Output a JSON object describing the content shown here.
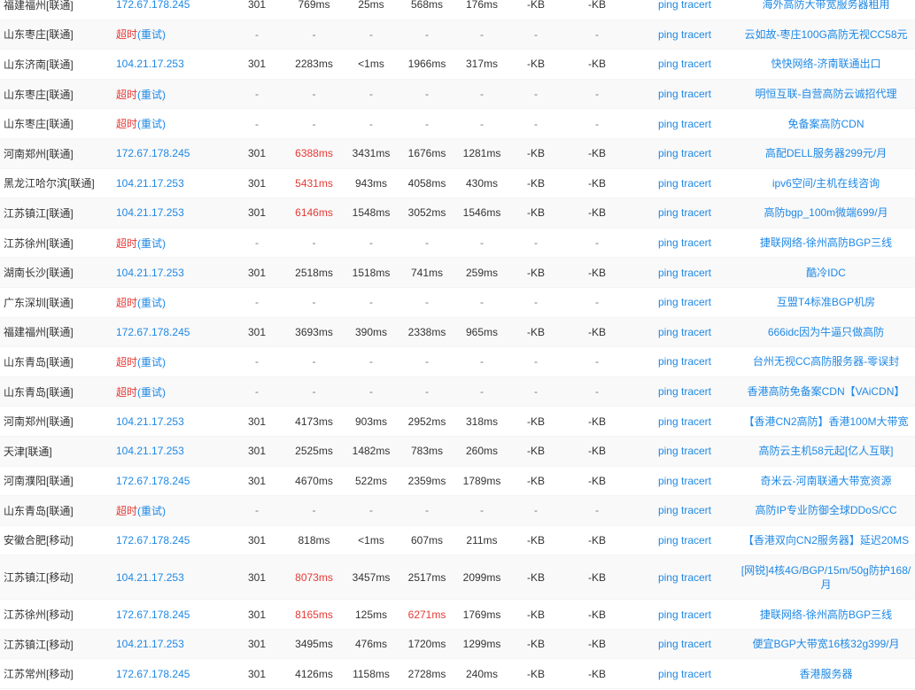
{
  "colors": {
    "link": "#1e88e5",
    "alert": "#e53935",
    "text": "#333333",
    "row_alt": "#f9f9f9"
  },
  "timeout_label": "超时",
  "retry_label": "(重试)",
  "dash": "-",
  "rows": [
    {
      "loc": "福建福州[联通]",
      "ip": "172.67.178.245",
      "status": "301",
      "t1": "769ms",
      "t2": "25ms",
      "t3": "568ms",
      "t4": "176ms",
      "kb1": "-KB",
      "kb2": "-KB",
      "ping": "ping",
      "tracert": "tracert",
      "ad": "海外高防大带宽服务器租用",
      "red": []
    },
    {
      "loc": "山东枣庄[联通]",
      "timeout": true,
      "ping": "ping",
      "tracert": "tracert",
      "ad": "云如故-枣庄100G高防无视CC58元"
    },
    {
      "loc": "山东济南[联通]",
      "ip": "104.21.17.253",
      "status": "301",
      "t1": "2283ms",
      "t2": "<1ms",
      "t3": "1966ms",
      "t4": "317ms",
      "kb1": "-KB",
      "kb2": "-KB",
      "ping": "ping",
      "tracert": "tracert",
      "ad": "快快网络-济南联通出口",
      "red": []
    },
    {
      "loc": "山东枣庄[联通]",
      "timeout": true,
      "ping": "ping",
      "tracert": "tracert",
      "ad": "明恒互联-自营高防云诚招代理"
    },
    {
      "loc": "山东枣庄[联通]",
      "timeout": true,
      "ping": "ping",
      "tracert": "tracert",
      "ad": "免备案高防CDN"
    },
    {
      "loc": "河南郑州[联通]",
      "ip": "172.67.178.245",
      "status": "301",
      "t1": "6388ms",
      "t2": "3431ms",
      "t3": "1676ms",
      "t4": "1281ms",
      "kb1": "-KB",
      "kb2": "-KB",
      "ping": "ping",
      "tracert": "tracert",
      "ad": "高配DELL服务器299元/月",
      "red": [
        "t1"
      ]
    },
    {
      "loc": "黑龙江哈尔滨[联通]",
      "ip": "104.21.17.253",
      "status": "301",
      "t1": "5431ms",
      "t2": "943ms",
      "t3": "4058ms",
      "t4": "430ms",
      "kb1": "-KB",
      "kb2": "-KB",
      "ping": "ping",
      "tracert": "tracert",
      "ad": "ipv6空间/主机在线咨询",
      "red": [
        "t1"
      ]
    },
    {
      "loc": "江苏镇江[联通]",
      "ip": "104.21.17.253",
      "status": "301",
      "t1": "6146ms",
      "t2": "1548ms",
      "t3": "3052ms",
      "t4": "1546ms",
      "kb1": "-KB",
      "kb2": "-KB",
      "ping": "ping",
      "tracert": "tracert",
      "ad": "高防bgp_100m微端699/月",
      "red": [
        "t1"
      ]
    },
    {
      "loc": "江苏徐州[联通]",
      "timeout": true,
      "ping": "ping",
      "tracert": "tracert",
      "ad": "捷联网络-徐州高防BGP三线"
    },
    {
      "loc": "湖南长沙[联通]",
      "ip": "104.21.17.253",
      "status": "301",
      "t1": "2518ms",
      "t2": "1518ms",
      "t3": "741ms",
      "t4": "259ms",
      "kb1": "-KB",
      "kb2": "-KB",
      "ping": "ping",
      "tracert": "tracert",
      "ad": "酷冷IDC",
      "red": []
    },
    {
      "loc": "广东深圳[联通]",
      "timeout": true,
      "ping": "ping",
      "tracert": "tracert",
      "ad": "互盟T4标准BGP机房"
    },
    {
      "loc": "福建福州[联通]",
      "ip": "172.67.178.245",
      "status": "301",
      "t1": "3693ms",
      "t2": "390ms",
      "t3": "2338ms",
      "t4": "965ms",
      "kb1": "-KB",
      "kb2": "-KB",
      "ping": "ping",
      "tracert": "tracert",
      "ad": "666idc因为牛逼只做高防",
      "red": []
    },
    {
      "loc": "山东青岛[联通]",
      "timeout": true,
      "ping": "ping",
      "tracert": "tracert",
      "ad": "台州无视CC高防服务器-零误封"
    },
    {
      "loc": "山东青岛[联通]",
      "timeout": true,
      "ping": "ping",
      "tracert": "tracert",
      "ad": "香港高防免备案CDN【VAiCDN】"
    },
    {
      "loc": "河南郑州[联通]",
      "ip": "104.21.17.253",
      "status": "301",
      "t1": "4173ms",
      "t2": "903ms",
      "t3": "2952ms",
      "t4": "318ms",
      "kb1": "-KB",
      "kb2": "-KB",
      "ping": "ping",
      "tracert": "tracert",
      "ad": "【香港CN2高防】香港100M大带宽",
      "red": []
    },
    {
      "loc": "天津[联通]",
      "ip": "104.21.17.253",
      "status": "301",
      "t1": "2525ms",
      "t2": "1482ms",
      "t3": "783ms",
      "t4": "260ms",
      "kb1": "-KB",
      "kb2": "-KB",
      "ping": "ping",
      "tracert": "tracert",
      "ad": "高防云主机58元起[亿人互联]",
      "red": []
    },
    {
      "loc": "河南濮阳[联通]",
      "ip": "172.67.178.245",
      "status": "301",
      "t1": "4670ms",
      "t2": "522ms",
      "t3": "2359ms",
      "t4": "1789ms",
      "kb1": "-KB",
      "kb2": "-KB",
      "ping": "ping",
      "tracert": "tracert",
      "ad": "奇米云-河南联通大带宽资源",
      "red": []
    },
    {
      "loc": "山东青岛[联通]",
      "timeout": true,
      "ping": "ping",
      "tracert": "tracert",
      "ad": "高防IP专业防御全球DDoS/CC"
    },
    {
      "loc": "安徽合肥[移动]",
      "ip": "172.67.178.245",
      "status": "301",
      "t1": "818ms",
      "t2": "<1ms",
      "t3": "607ms",
      "t4": "211ms",
      "kb1": "-KB",
      "kb2": "-KB",
      "ping": "ping",
      "tracert": "tracert",
      "ad": "【香港双向CN2服务器】延迟20MS",
      "red": []
    },
    {
      "loc": "江苏镇江[移动]",
      "ip": "104.21.17.253",
      "status": "301",
      "t1": "8073ms",
      "t2": "3457ms",
      "t3": "2517ms",
      "t4": "2099ms",
      "kb1": "-KB",
      "kb2": "-KB",
      "ping": "ping",
      "tracert": "tracert",
      "ad": "[网锐]4核4G/BGP/15m/50g防护168/月",
      "red": [
        "t1"
      ],
      "tall": true
    },
    {
      "loc": "江苏徐州[移动]",
      "ip": "172.67.178.245",
      "status": "301",
      "t1": "8165ms",
      "t2": "125ms",
      "t3": "6271ms",
      "t4": "1769ms",
      "kb1": "-KB",
      "kb2": "-KB",
      "ping": "ping",
      "tracert": "tracert",
      "ad": "捷联网络-徐州高防BGP三线",
      "red": [
        "t1",
        "t3"
      ]
    },
    {
      "loc": "江苏镇江[移动]",
      "ip": "104.21.17.253",
      "status": "301",
      "t1": "3495ms",
      "t2": "476ms",
      "t3": "1720ms",
      "t4": "1299ms",
      "kb1": "-KB",
      "kb2": "-KB",
      "ping": "ping",
      "tracert": "tracert",
      "ad": "便宜BGP大带宽16核32g399/月",
      "red": []
    },
    {
      "loc": "江苏常州[移动]",
      "ip": "172.67.178.245",
      "status": "301",
      "t1": "4126ms",
      "t2": "1158ms",
      "t3": "2728ms",
      "t4": "240ms",
      "kb1": "-KB",
      "kb2": "-KB",
      "ping": "ping",
      "tracert": "tracert",
      "ad": "香港服务器",
      "red": []
    }
  ]
}
